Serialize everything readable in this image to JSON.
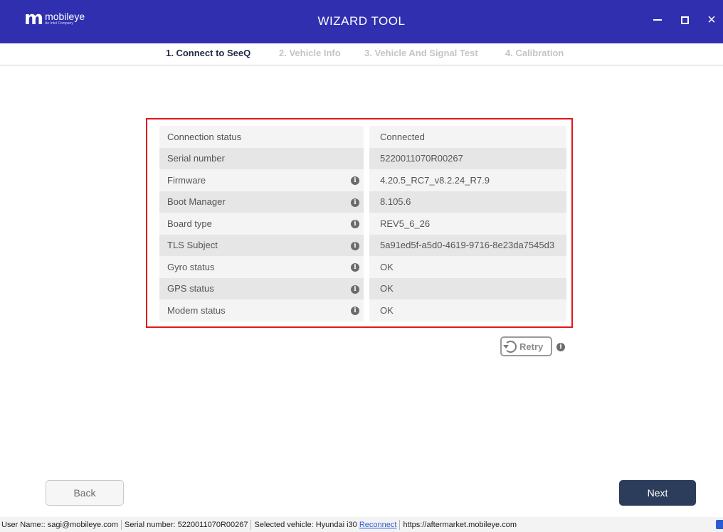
{
  "titlebar": {
    "logo_mark": "m",
    "logo_text": "mobileye",
    "logo_subtext": "An Intel Company",
    "title": "WIZARD TOOL",
    "controls": [
      "minimize-icon",
      "maximize-icon",
      "close-icon"
    ],
    "close_glyph": "×",
    "color": "#2f2fb0"
  },
  "steps": [
    {
      "label": "1. Connect to SeeQ",
      "active": true
    },
    {
      "label": "2. Vehicle Info",
      "active": false
    },
    {
      "label": "3. Vehicle And Signal Test",
      "active": false
    },
    {
      "label": "4. Calibration",
      "active": false
    }
  ],
  "info_table": {
    "rows": [
      {
        "label": "Connection status",
        "value": "Connected",
        "info_icon": false
      },
      {
        "label": "Serial number",
        "value": "5220011070R00267",
        "info_icon": false
      },
      {
        "label": "Firmware",
        "value": "4.20.5_RC7_v8.2.24_R7.9",
        "info_icon": true
      },
      {
        "label": "Boot Manager",
        "value": "8.105.6",
        "info_icon": true
      },
      {
        "label": "Board type",
        "value": "REV5_6_26",
        "info_icon": true
      },
      {
        "label": "TLS Subject",
        "value": "5a91ed5f-a5d0-4619-9716-8e23da7545d3",
        "info_icon": true
      },
      {
        "label": "Gyro status",
        "value": "OK",
        "info_icon": true
      },
      {
        "label": "GPS status",
        "value": "OK",
        "info_icon": true
      },
      {
        "label": "Modem status",
        "value": "OK",
        "info_icon": true
      }
    ],
    "highlight_color": "#e0171d"
  },
  "retry": {
    "label": "Retry"
  },
  "info_glyph": "i",
  "buttons": {
    "back": "Back",
    "next": "Next"
  },
  "statusbar": {
    "user": "User Name:: sagi@mobileye.com",
    "serial": "Serial number: 5220011070R00267",
    "vehicle": "Selected vehicle: Hyundai i30",
    "reconnect": "Reconnect",
    "url": "https://aftermarket.mobileye.com"
  }
}
